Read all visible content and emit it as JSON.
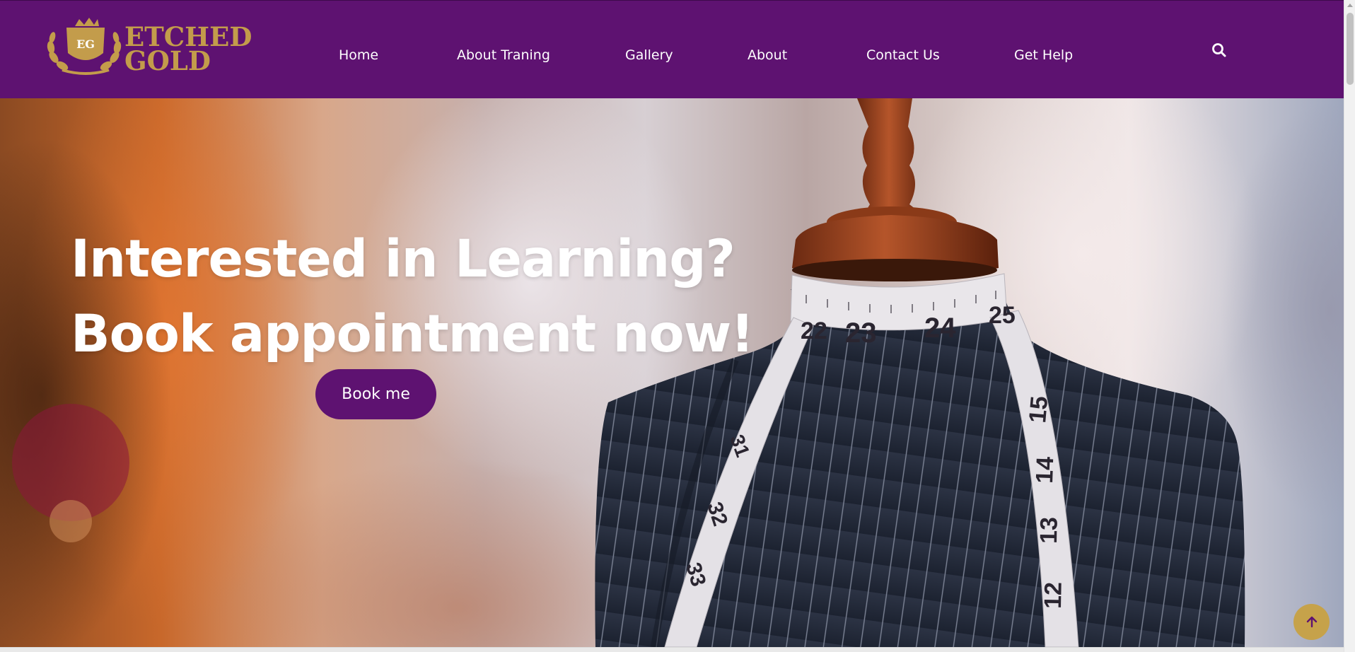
{
  "brand": {
    "logo_line1": "ETCHED",
    "logo_line2": "GOLD",
    "logo_monogram": "EG",
    "color_primary": "#5e1271",
    "color_gold": "#c39c4b"
  },
  "nav": {
    "items": [
      {
        "label": "Home"
      },
      {
        "label": "About Traning"
      },
      {
        "label": "Gallery"
      },
      {
        "label": "About"
      },
      {
        "label": "Contact Us"
      },
      {
        "label": "Get Help"
      }
    ],
    "search_icon": "search-icon"
  },
  "hero": {
    "headline_line1": "Interested in Learning?",
    "headline_line2": "Book appointment now!",
    "cta_label": "Book me",
    "tape_numbers": [
      "22",
      "23",
      "24",
      "25",
      "15",
      "14",
      "13",
      "12",
      "31",
      "32",
      "33"
    ]
  },
  "scroll_top": {
    "icon": "arrow-up-icon"
  }
}
